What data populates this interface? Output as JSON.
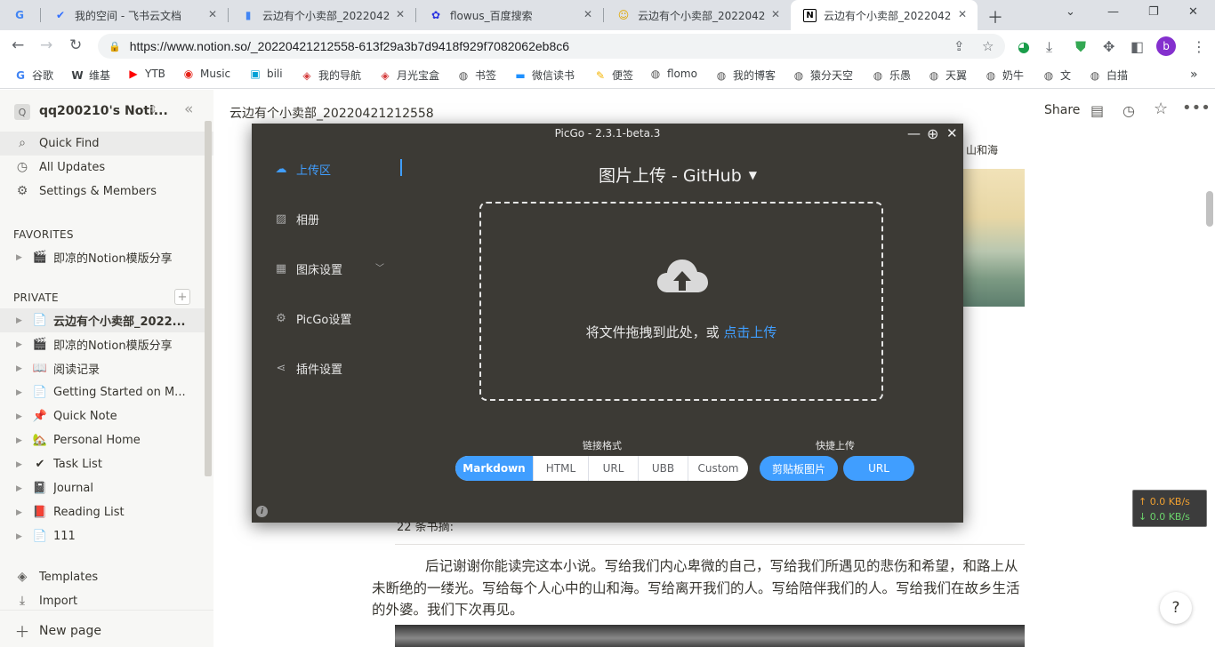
{
  "browser": {
    "tabs": [
      {
        "icon": "G",
        "icon_color": "#4285f4",
        "label": "",
        "active": false
      },
      {
        "icon": "✔",
        "icon_color": "#3370ff",
        "label": "我的空间 - 飞书云文档",
        "active": false
      },
      {
        "icon": "▮",
        "icon_color": "#4285f4",
        "label": "云边有个小卖部_2022042",
        "active": false
      },
      {
        "icon": "✿",
        "icon_color": "#2932e1",
        "label": "flowus_百度搜索",
        "active": false
      },
      {
        "icon": "☺",
        "icon_color": "#e0a800",
        "label": "云边有个小卖部_2022042",
        "active": false
      },
      {
        "icon": "N",
        "icon_color": "#000000",
        "label": "云边有个小卖部_2022042",
        "active": true
      }
    ],
    "url": "https://www.notion.so/_20220421212558-613f29a3b7d9418f929f7082062eb8c6",
    "profile_initial": "b",
    "bookmarks": [
      {
        "icon": "G",
        "color": "#4285f4",
        "label": "谷歌"
      },
      {
        "icon": "W",
        "color": "#000000",
        "label": "维基"
      },
      {
        "icon": "▶",
        "color": "#ff0000",
        "label": "YTB"
      },
      {
        "icon": "◉",
        "color": "#e62117",
        "label": "Music"
      },
      {
        "icon": "▣",
        "color": "#00a1d6",
        "label": "bili"
      },
      {
        "icon": "◈",
        "color": "#d43c3c",
        "label": "我的导航"
      },
      {
        "icon": "◈",
        "color": "#d43c3c",
        "label": "月光宝盒"
      },
      {
        "icon": "◍",
        "color": "#555555",
        "label": "书签"
      },
      {
        "icon": "▬",
        "color": "#1e90ff",
        "label": "微信读书"
      },
      {
        "icon": "✎",
        "color": "#f4b400",
        "label": "便签"
      },
      {
        "icon": "◍",
        "color": "#555555",
        "label": "flomo"
      },
      {
        "icon": "◍",
        "color": "#555555",
        "label": "我的博客"
      },
      {
        "icon": "◍",
        "color": "#555555",
        "label": "猿分天空"
      },
      {
        "icon": "◍",
        "color": "#555555",
        "label": "乐愚"
      },
      {
        "icon": "◍",
        "color": "#555555",
        "label": "天翼"
      },
      {
        "icon": "◍",
        "color": "#555555",
        "label": "奶牛"
      },
      {
        "icon": "◍",
        "color": "#555555",
        "label": "文"
      },
      {
        "icon": "◍",
        "color": "#555555",
        "label": "白描"
      }
    ],
    "bookmarks_overflow": "»"
  },
  "notion": {
    "workspace_name": "qq200210's Noti...",
    "quick_find": "Quick Find",
    "all_updates": "All Updates",
    "settings": "Settings & Members",
    "favorites_title": "FAVORITES",
    "favorites": [
      {
        "icon": "🎬",
        "label": "即凉的Notion模版分享"
      }
    ],
    "private_title": "PRIVATE",
    "private_add": "+",
    "private": [
      {
        "icon": "📄",
        "label": "云边有个小卖部_2022...",
        "bold": true
      },
      {
        "icon": "🎬",
        "label": "即凉的Notion模版分享"
      },
      {
        "icon": "📖",
        "label": "阅读记录"
      },
      {
        "icon": "📄",
        "label": "Getting Started on M..."
      },
      {
        "icon": "📌",
        "label": "Quick Note"
      },
      {
        "icon": "🏡",
        "label": "Personal Home"
      },
      {
        "icon": "✔",
        "label": "Task List"
      },
      {
        "icon": "📓",
        "label": "Journal"
      },
      {
        "icon": "📕",
        "label": "Reading List"
      },
      {
        "icon": "📄",
        "label": "111"
      }
    ],
    "templates": "Templates",
    "import": "Import",
    "new_page": "New page",
    "breadcrumb": "云边有个小卖部_20220421212558",
    "share": "Share",
    "caption_top": "山和海",
    "book_count": "22 条书摘:",
    "paragraph": "后记谢谢你能读完这本小说。写给我们内心卑微的自己，写给我们所遇见的悲伤和希望，和路上从未断绝的一缕光。写给每个人心中的山和海。写给离开我们的人。写给陪伴我们的人。写给我们在故乡生活的外婆。我们下次再见。",
    "help": "?"
  },
  "network": {
    "up": "↑ 0.0 KB/s",
    "down": "↓ 0.0 KB/s"
  },
  "picgo": {
    "title": "PicGo - 2.3.1-beta.3",
    "nav": [
      {
        "icon": "upload-cloud-icon",
        "label": "上传区",
        "active": true
      },
      {
        "icon": "image-icon",
        "label": "相册",
        "active": false
      },
      {
        "icon": "grid-icon",
        "label": "图床设置",
        "active": false
      },
      {
        "icon": "gear-icon",
        "label": "PicGo设置",
        "active": false
      },
      {
        "icon": "share-icon",
        "label": "插件设置",
        "active": false
      }
    ],
    "heading": "图片上传 - GitHub",
    "drop_text": "将文件拖拽到此处，或 ",
    "drop_link": "点击上传",
    "link_format_label": "链接格式",
    "link_formats": [
      "Markdown",
      "HTML",
      "URL",
      "UBB",
      "Custom"
    ],
    "selected_format": "Markdown",
    "quick_upload_label": "快捷上传",
    "quick_buttons": [
      "剪贴板图片",
      "URL"
    ],
    "accent": "#409eff"
  }
}
